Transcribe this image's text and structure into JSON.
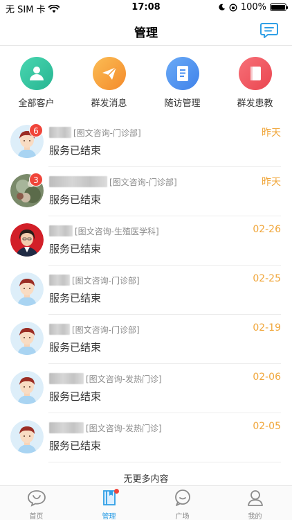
{
  "status_bar": {
    "carrier": "无 SIM 卡",
    "time": "17:08",
    "battery": "100%"
  },
  "nav": {
    "title": "管理"
  },
  "quick_actions": [
    {
      "label": "全部客户",
      "icon": "users-icon",
      "color": "#36c7a3"
    },
    {
      "label": "群发消息",
      "icon": "paper-plane-icon",
      "color": "#f7a43a"
    },
    {
      "label": "随访管理",
      "icon": "document-icon",
      "color": "#4a94f0"
    },
    {
      "label": "群发患教",
      "icon": "book-icon",
      "color": "#f0555f"
    }
  ],
  "conversations": [
    {
      "tag": "[图文咨询-门诊部]",
      "message": "服务已结束",
      "time": "昨天",
      "badge": "6",
      "avatar": "male-cartoon"
    },
    {
      "tag": "[图文咨询-门诊部]",
      "message": "服务已结束",
      "time": "昨天",
      "badge": "3",
      "avatar": "photo"
    },
    {
      "tag": "[图文咨询-生殖医学科]",
      "message": "服务已结束",
      "time": "02-26",
      "badge": "",
      "avatar": "female-photo"
    },
    {
      "tag": "[图文咨询-门诊部]",
      "message": "服务已结束",
      "time": "02-25",
      "badge": "",
      "avatar": "male-cartoon"
    },
    {
      "tag": "[图文咨询-门诊部]",
      "message": "服务已结束",
      "time": "02-19",
      "badge": "",
      "avatar": "male-cartoon"
    },
    {
      "tag": "[图文咨询-发热门诊]",
      "message": "服务已结束",
      "time": "02-06",
      "badge": "",
      "avatar": "male-cartoon"
    },
    {
      "tag": "[图文咨询-发热门诊]",
      "message": "服务已结束",
      "time": "02-05",
      "badge": "",
      "avatar": "male-cartoon"
    }
  ],
  "footer_text": "无更多内容",
  "tabs": [
    {
      "label": "首页",
      "icon": "heart-bubble-icon"
    },
    {
      "label": "管理",
      "icon": "book-icon",
      "active": true
    },
    {
      "label": "广场",
      "icon": "chat-icon"
    },
    {
      "label": "我的",
      "icon": "user-icon"
    }
  ],
  "colors": {
    "accent": "#2f9fe6",
    "time": "#f0a63a",
    "badge": "#f0453a"
  }
}
